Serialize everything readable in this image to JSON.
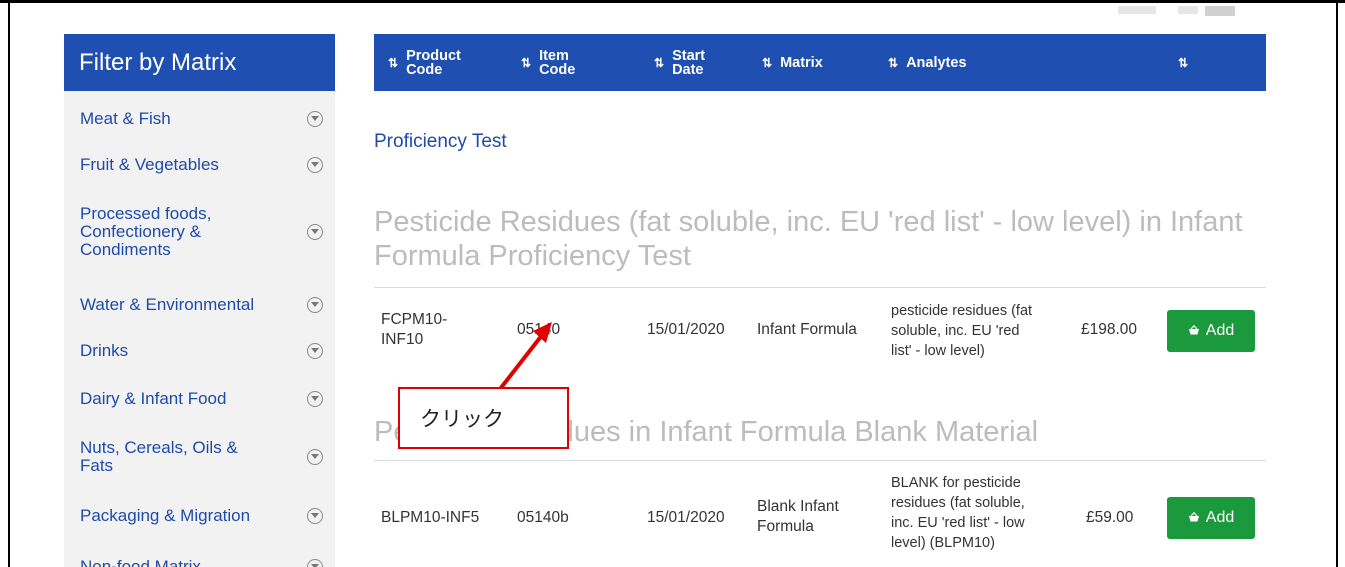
{
  "sidebar": {
    "title": "Filter by Matrix",
    "items": [
      {
        "label": "Meat & Fish",
        "icon": "chevron-down-circle-icon"
      },
      {
        "label": "Fruit & Vegetables",
        "icon": "chevron-down-circle-icon"
      },
      {
        "label": "Processed foods,\nConfectionery &\nCondiments",
        "icon": "chevron-down-circle-icon"
      },
      {
        "label": "Water & Environmental",
        "icon": "chevron-down-circle-icon"
      },
      {
        "label": "Drinks",
        "icon": "chevron-down-circle-icon"
      },
      {
        "label": "Dairy & Infant Food",
        "icon": "chevron-down-circle-icon"
      },
      {
        "label": "Nuts, Cereals, Oils &\nFats",
        "icon": "chevron-down-circle-icon"
      },
      {
        "label": "Packaging & Migration",
        "icon": "chevron-down-circle-icon"
      },
      {
        "label": "Non-food Matrix",
        "icon": "chevron-down-circle-icon"
      }
    ]
  },
  "table": {
    "columns": [
      {
        "label": "Product\nCode",
        "sort_icon": "sort-icon"
      },
      {
        "label": "Item\nCode",
        "sort_icon": "sort-asc-icon"
      },
      {
        "label": "Start\nDate",
        "sort_icon": "sort-icon"
      },
      {
        "label": "Matrix",
        "sort_icon": "sort-icon"
      },
      {
        "label": "Analytes",
        "sort_icon": "sort-icon"
      },
      {
        "label": "",
        "sort_icon": "sort-icon"
      }
    ],
    "sort_glyph": "⇅",
    "sort_asc_glyph": "⇅"
  },
  "section": {
    "title": "Proficiency Test"
  },
  "products": [
    {
      "title": "Pesticide Residues (fat soluble, inc. EU 'red list' - low level) in Infant Formula Proficiency Test",
      "row": {
        "product_code": "FCPM10-\nINF10",
        "item_code": "05140",
        "start_date": "15/01/2020",
        "matrix": "Infant Formula",
        "analytes": "pesticide residues (fat\nsoluble, inc. EU 'red\nlist' - low level)",
        "price": "£198.00",
        "add_label": "Add"
      }
    },
    {
      "title": "Pesticide Residues in Infant Formula Blank Material",
      "row": {
        "product_code": "BLPM10-INF5",
        "item_code": "05140b",
        "start_date": "15/01/2020",
        "matrix": "Blank Infant\nFormula",
        "analytes": "BLANK for pesticide\nresidues (fat soluble,\ninc. EU 'red list' - low\nlevel) (BLPM10)",
        "price": "£59.00",
        "add_label": "Add"
      }
    }
  ],
  "annotation": {
    "text": "クリック",
    "color": "#e00000"
  },
  "colors": {
    "header_blue": "#1f4fb0",
    "link_blue": "#1f4aa8",
    "add_green": "#1a9a3c",
    "title_gray": "#bcbcbc"
  }
}
